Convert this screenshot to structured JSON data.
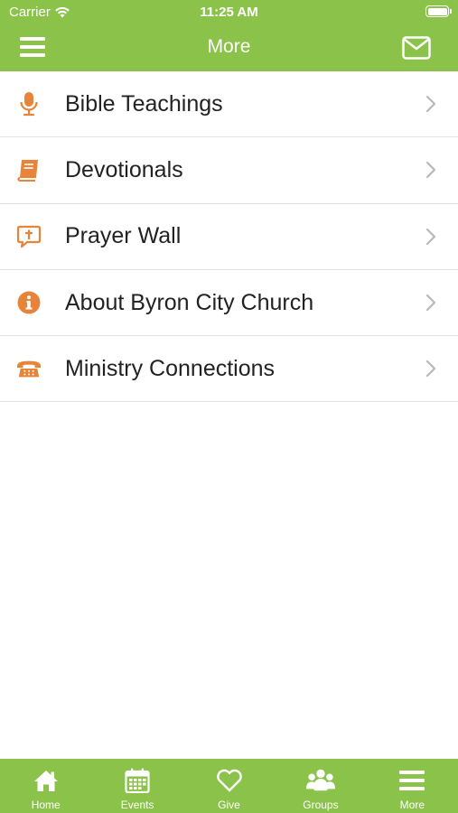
{
  "status_bar": {
    "carrier": "Carrier",
    "time": "11:25 AM"
  },
  "nav": {
    "title": "More"
  },
  "menu": {
    "items": [
      {
        "label": "Bible Teachings",
        "icon": "microphone-icon"
      },
      {
        "label": "Devotionals",
        "icon": "book-icon"
      },
      {
        "label": "Prayer Wall",
        "icon": "cross-chat-icon"
      },
      {
        "label": "About Byron City Church",
        "icon": "info-icon"
      },
      {
        "label": "Ministry Connections",
        "icon": "telephone-icon"
      }
    ]
  },
  "tabs": [
    {
      "label": "Home",
      "icon": "home-icon"
    },
    {
      "label": "Events",
      "icon": "calendar-icon"
    },
    {
      "label": "Give",
      "icon": "heart-icon"
    },
    {
      "label": "Groups",
      "icon": "groups-icon"
    },
    {
      "label": "More",
      "icon": "menu-icon"
    }
  ],
  "colors": {
    "accent": "#8bc34a",
    "icon": "#e8843a",
    "text": "#222222",
    "divider": "#e3e3e3"
  }
}
